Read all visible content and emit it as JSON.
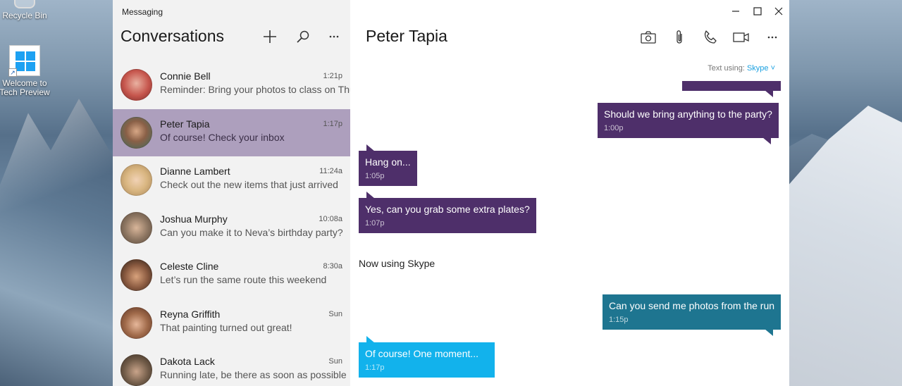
{
  "desktop": {
    "icons": [
      {
        "label": "Recycle Bin"
      },
      {
        "label": "Welcome to Tech Preview"
      }
    ]
  },
  "app": {
    "title": "Messaging"
  },
  "sidebar": {
    "header": "Conversations",
    "actions": {
      "new": "add-icon",
      "search": "search-icon",
      "more": "more-icon"
    },
    "conversations": [
      {
        "name": "Connie Bell",
        "time": "1:21p",
        "preview": "Reminder: Bring your photos to class on Thursday",
        "color": "#c6564d"
      },
      {
        "name": "Peter Tapia",
        "time": "1:17p",
        "preview": "Of course! Check your inbox",
        "color": "#3f6b5e"
      },
      {
        "name": "Dianne Lambert",
        "time": "11:24a",
        "preview": "Check out the new items that just arrived",
        "color": "#d9b681"
      },
      {
        "name": "Joshua Murphy",
        "time": "10:08a",
        "preview": "Can you make it to Neva’s birthday party?",
        "color": "#8c7561"
      },
      {
        "name": "Celeste Cline",
        "time": "8:30a",
        "preview": "Let’s run the same route this weekend",
        "color": "#5b3b2c"
      },
      {
        "name": "Reyna Griffith",
        "time": "Sun",
        "preview": "That painting turned out great!",
        "color": "#7a4f39"
      },
      {
        "name": "Dakota Lack",
        "time": "Sun",
        "preview": "Running late, be there as soon as possible",
        "color": "#6f5a47"
      }
    ]
  },
  "chat": {
    "contact": "Peter Tapia",
    "text_using_label": "Text using:",
    "service": "Skype",
    "system_message": "Now using Skype",
    "messages": [
      {
        "text": "Should we bring anything to the party?",
        "time": "1:00p"
      },
      {
        "text": "Hang on...",
        "time": "1:05p"
      },
      {
        "text": "Yes, can you grab some extra plates?",
        "time": "1:07p"
      },
      {
        "text": "Can you send me photos from the run",
        "time": "1:15p"
      },
      {
        "text": "Of course!  One moment...",
        "time": "1:17p"
      }
    ]
  },
  "colors": {
    "accent_purple": "#4e2f6a",
    "selected_row": "#ad9fbd",
    "skype_teal": "#1e7590",
    "skype_cyan": "#12b2ec",
    "link_blue": "#1aa0e0"
  }
}
